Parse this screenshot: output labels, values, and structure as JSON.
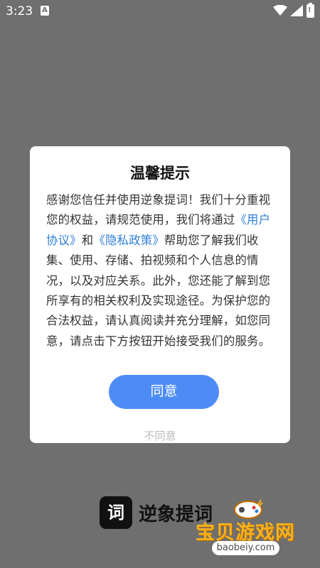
{
  "status_bar": {
    "time": "3:23",
    "notification_icon": "a-icon",
    "wifi_icon": "wifi-icon",
    "signal_icon": "signal-icon",
    "battery_icon": "battery-icon",
    "battery_mark": "!"
  },
  "dialog": {
    "title": "温馨提示",
    "body_part1": "感谢您信任并使用逆象提词！我们十分重视您的权益，请规范使用，我们将通过",
    "link_user_agreement": "《用户协议》",
    "and_text": "和",
    "link_privacy_policy": "《隐私政策》",
    "body_part2": "帮助您了解我们收集、使用、存储、拍视频和个人信息的情况，以及对应关系。此外，您还能了解到您所享有的相关权利及实现途径。为保护您的合法权益，请认真阅读并充分理解，如您同意，请点击下方按钮开始接受我们的服务。",
    "agree_label": "同意",
    "disagree_label": "不同意"
  },
  "app": {
    "logo_char": "词",
    "name": "逆象提词"
  },
  "watermark": {
    "text": "宝贝游戏网",
    "url": "baobeiy.com"
  },
  "colors": {
    "overlay": "#6f6f6f",
    "accent": "#4d8cf5",
    "link": "#2f7fd9"
  }
}
